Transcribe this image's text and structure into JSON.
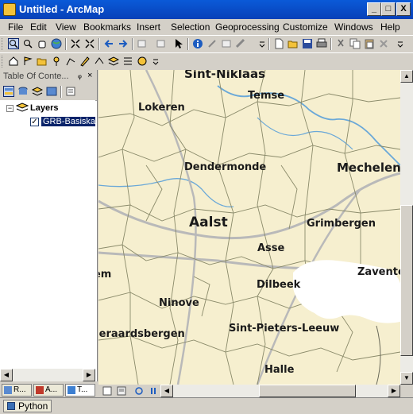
{
  "window": {
    "title": "Untitled - ArcMap",
    "min_label": "_",
    "max_label": "□",
    "close_label": "X"
  },
  "menu": [
    "File",
    "Edit",
    "View",
    "Bookmarks",
    "Insert",
    "Selection",
    "Geoprocessing",
    "Customize",
    "Windows",
    "Help"
  ],
  "toc": {
    "title": "Table Of Conte...",
    "pin_label": "ᵩ",
    "close_label": "×",
    "root_label": "Layers",
    "layer_label": "GRB-Basiskaa",
    "tabs": [
      "R...",
      "A...",
      "T..."
    ]
  },
  "map": {
    "cities": [
      {
        "name": "Sint-Niklaas"
      },
      {
        "name": "Temse"
      },
      {
        "name": "Lokeren"
      },
      {
        "name": "Dendermonde"
      },
      {
        "name": "Mechelen"
      },
      {
        "name": "Aalst"
      },
      {
        "name": "Grimbergen"
      },
      {
        "name": "Asse"
      },
      {
        "name": "Zaventem"
      },
      {
        "name": "Ninove"
      },
      {
        "name": "Dilbeek"
      },
      {
        "name": "Geraardsbergen"
      },
      {
        "name": "Sint-Pieters-Leeuw"
      },
      {
        "name": "Halle"
      },
      {
        "name": "Zottegem"
      }
    ],
    "colors": {
      "land": "#f6efcf",
      "borders": "#8a8a6a",
      "rivers": "#6aa8d8",
      "roads": "#b9b9b9",
      "brussels": "#ffffff"
    }
  },
  "python": {
    "label": "Python"
  }
}
